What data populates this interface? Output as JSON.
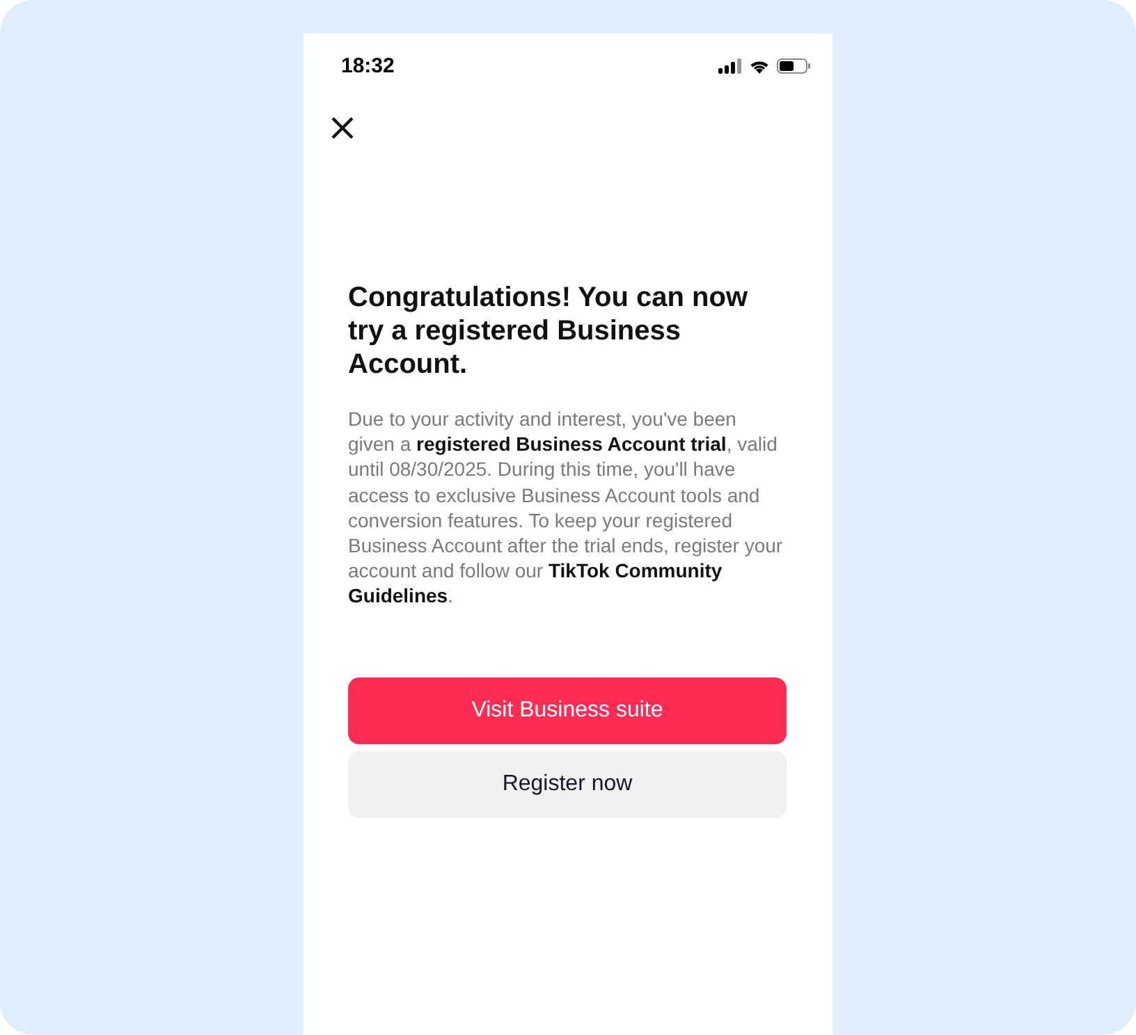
{
  "status_bar": {
    "time": "18:32"
  },
  "dialog": {
    "title": "Congratulations! You can now try a registered Business Account.",
    "body": "Due to your activity and interest, you've been given a **registered Business Account trial**, valid until 08/30/2025. During this time, you'll have access to exclusive Business Account tools and conversion features. To keep your registered Business Account after the trial ends, register your account and follow our **TikTok Community Guidelines**.",
    "buttons": [
      {
        "label": "Visit Business suite",
        "kind": "primary"
      },
      {
        "label": "Register now",
        "kind": "secondary"
      }
    ]
  }
}
